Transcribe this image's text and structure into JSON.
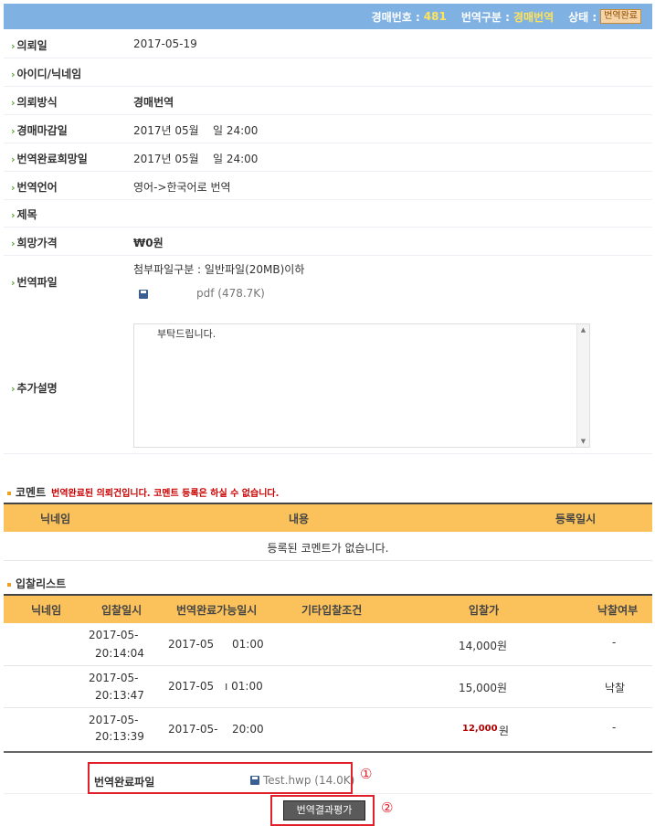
{
  "header": {
    "auction_no_label": "경매번호 :",
    "auction_no": "481",
    "type_label": "번역구분 :",
    "type_value": "경매번역",
    "status_label": "상태 :",
    "status_value": "번역완료"
  },
  "fields": {
    "request_date": {
      "label": "의뢰일",
      "value": "2017-05-19"
    },
    "user_id": {
      "label": "아이디/닉네임",
      "value": ""
    },
    "request_method": {
      "label": "의뢰방식",
      "value": "경매번역"
    },
    "auction_deadline": {
      "label": "경매마감일",
      "value": "2017년 05월    일 24:00"
    },
    "desired_completion": {
      "label": "번역완료희망일",
      "value": "2017년 05월    일 24:00"
    },
    "language": {
      "label": "번역언어",
      "value": "영어->한국어로 번역"
    },
    "title": {
      "label": "제목",
      "value": ""
    },
    "desired_price": {
      "label": "희망가격",
      "value": "₩0원"
    },
    "translation_file": {
      "label": "번역파일",
      "note": "첨부파일구분 : 일반파일(20MB)이하",
      "file_name": "pdf (478.7K)"
    },
    "extra_desc": {
      "label": "추가설명",
      "value": "부탁드립니다."
    }
  },
  "comments": {
    "title": "코멘트",
    "warning": "번역완료된 의뢰건입니다. 코멘트 등록은 하실 수 없습니다.",
    "columns": [
      "닉네임",
      "내용",
      "등록일시"
    ],
    "empty_text": "등록된 코멘트가 없습니다."
  },
  "bids": {
    "title": "입찰리스트",
    "columns": [
      "닉네임",
      "입찰일시",
      "번역완료가능일시",
      "기타입찰조건",
      "입찰가",
      "낙찰여부"
    ],
    "rows": [
      {
        "date1": "2017-05-",
        "date2": "20:14:04",
        "done1": "2017-05",
        "done2": "01:00",
        "price": "14,000원",
        "result": "-"
      },
      {
        "date1": "2017-05-",
        "date2": "20:13:47",
        "done1": "2017-05",
        "done2": "ı 01:00",
        "price": "15,000원",
        "result": "낙찰"
      },
      {
        "date1": "2017-05-",
        "date2": "20:13:39",
        "done1": "2017-05-",
        "done2": "20:00",
        "price_num": "12,000",
        "price_unit": "원",
        "result": "-"
      }
    ]
  },
  "completion": {
    "label": "번역완료파일",
    "file_name": "Test.hwp (14.0K)",
    "marker1": "①",
    "marker2": "②",
    "eval_button": "번역결과평가"
  }
}
